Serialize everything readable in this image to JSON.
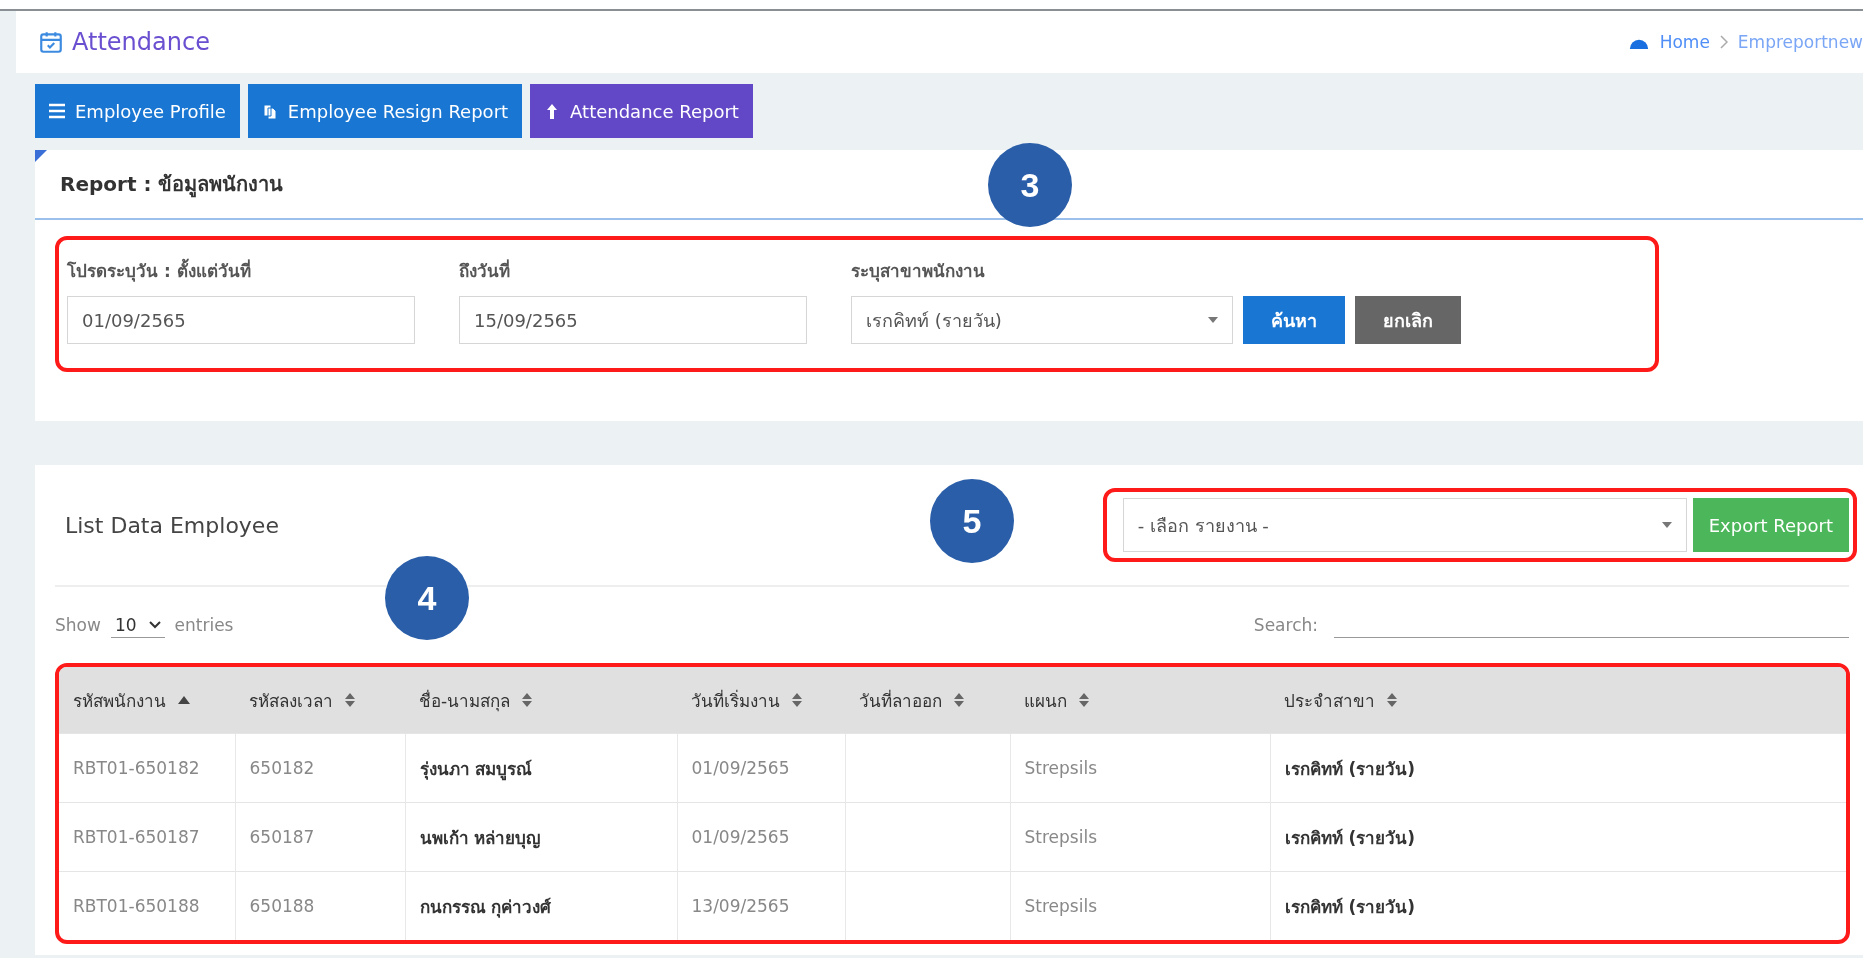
{
  "header": {
    "title": "Attendance",
    "breadcrumb": [
      "Home",
      "Empreportnew"
    ]
  },
  "nav_buttons": [
    {
      "label": "Employee Profile",
      "selected": false
    },
    {
      "label": "Employee Resign Report",
      "selected": false
    },
    {
      "label": "Attendance Report",
      "selected": true
    }
  ],
  "report_card": {
    "title": "Report : ข้อมูลพนักงาน",
    "step": "3",
    "filters": [
      {
        "kind": "input",
        "label": "โปรดระบุวัน : ตั้งแต่วันที่",
        "value": "01/09/2565"
      },
      {
        "kind": "input",
        "label": "ถึงวันที่",
        "value": "15/09/2565"
      },
      {
        "kind": "select",
        "label": "ระบุสาขาพนักงาน",
        "value": "เรกคิทท์ (รายวัน)"
      }
    ],
    "buttons": [
      {
        "label": "ค้นหา",
        "kind": "primary"
      },
      {
        "label": "ยกเลิก",
        "kind": "secondary"
      }
    ]
  },
  "list_card": {
    "title": "List Data Employee",
    "export_step": "5",
    "report_select": "- เลือก รายงาน -",
    "export_button": "Export Report",
    "table_step": "4",
    "show_label": "Show",
    "entries_value": "10",
    "entries_label": "entries",
    "search_label": "Search:"
  },
  "table": {
    "columns": [
      {
        "label": "รหัสพนักงาน",
        "sorted": true
      },
      {
        "label": "รหัสลงเวลา",
        "sorted": false
      },
      {
        "label": "ชื่อ-นามสกุล",
        "sorted": false
      },
      {
        "label": "วันที่เริ่มงาน",
        "sorted": false
      },
      {
        "label": "วันที่ลาออก",
        "sorted": false
      },
      {
        "label": "แผนก",
        "sorted": false
      },
      {
        "label": "ประจำสาขา",
        "sorted": false
      }
    ],
    "rows": [
      [
        "RBT01-650182",
        "650182",
        "รุ่งนภา สมบูรณ์",
        "01/09/2565",
        "",
        "Strepsils",
        "เรกคิทท์ (รายวัน)"
      ],
      [
        "RBT01-650187",
        "650187",
        "นพเก้า หล่ายบุญ",
        "01/09/2565",
        "",
        "Strepsils",
        "เรกคิทท์ (รายวัน)"
      ],
      [
        "RBT01-650188",
        "650188",
        "กนกรรณ กุค่าวงศ์",
        "13/09/2565",
        "",
        "Strepsils",
        "เรกคิทท์ (รายวัน)"
      ]
    ]
  }
}
